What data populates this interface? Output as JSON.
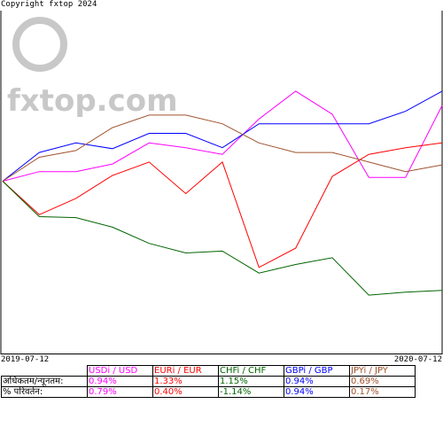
{
  "copyright": "Copyright fxtop 2024",
  "watermark": {
    "text": "fxtop.com",
    "color": "#c8c8c8"
  },
  "chart_data": {
    "type": "line",
    "x": [
      "2019-07-12",
      "2019-08-12",
      "2019-09-12",
      "2019-10-12",
      "2019-11-12",
      "2019-12-12",
      "2020-01-12",
      "2020-02-12",
      "2020-03-12",
      "2020-04-12",
      "2020-05-12",
      "2020-06-12",
      "2020-07-12"
    ],
    "xlabel_start": "2019-07-12",
    "xlabel_end": "2020-07-12",
    "ylim": [
      -1.8,
      1.8
    ],
    "grid": false,
    "series": [
      {
        "name": "USDi / USD",
        "color": "#ff00ff",
        "values": [
          0,
          0.1,
          0.1,
          0.18,
          0.4,
          0.35,
          0.28,
          0.65,
          0.94,
          0.7,
          0.04,
          0.04,
          0.79
        ]
      },
      {
        "name": "EURi / EUR",
        "color": "#ff0000",
        "values": [
          0,
          -0.35,
          -0.18,
          0.06,
          0.2,
          -0.13,
          0.2,
          -0.9,
          -0.7,
          0.05,
          0.28,
          0.35,
          0.4
        ]
      },
      {
        "name": "CHFi / CHF",
        "color": "#006400",
        "values": [
          0,
          -0.37,
          -0.38,
          -0.48,
          -0.65,
          -0.75,
          -0.73,
          -0.96,
          -0.87,
          -0.8,
          -1.19,
          -1.16,
          -1.14
        ]
      },
      {
        "name": "GBPi / GBP",
        "color": "#0000ff",
        "values": [
          0,
          0.3,
          0.4,
          0.34,
          0.5,
          0.5,
          0.35,
          0.6,
          0.6,
          0.6,
          0.6,
          0.73,
          0.94
        ]
      },
      {
        "name": "JPYi / JPY",
        "color": "#a0522d",
        "values": [
          0,
          0.25,
          0.32,
          0.56,
          0.69,
          0.69,
          0.6,
          0.4,
          0.3,
          0.3,
          0.2,
          0.1,
          0.17
        ]
      }
    ]
  },
  "stats": {
    "row1_label": "अधिकतम/न्यूनतम:",
    "row2_label": "% परिवर्तन:",
    "currencies": [
      {
        "name": "USDi / USD",
        "color": "#ff00ff",
        "maxmin": "0.94%",
        "change": "0.79%"
      },
      {
        "name": "EURi / EUR",
        "color": "#ff0000",
        "maxmin": "1.33%",
        "change": "0.40%"
      },
      {
        "name": "CHFi / CHF",
        "color": "#006400",
        "maxmin": "1.15%",
        "change": "-1.14%"
      },
      {
        "name": "GBPi / GBP",
        "color": "#0000ff",
        "maxmin": "0.94%",
        "change": "0.94%"
      },
      {
        "name": "JPYi / JPY",
        "color": "#a0522d",
        "maxmin": "0.69%",
        "change": "0.17%"
      }
    ]
  }
}
